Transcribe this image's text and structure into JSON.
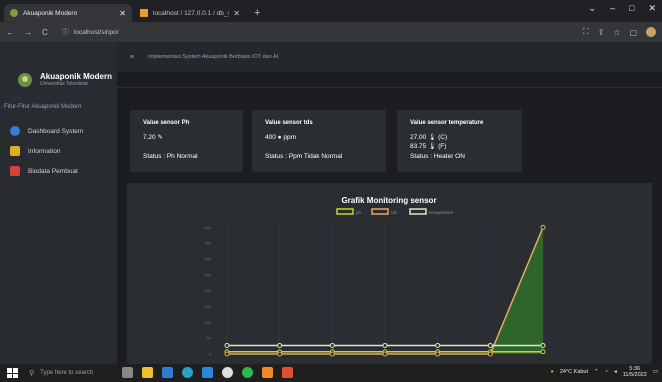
{
  "browser": {
    "tabs": [
      {
        "title": "Akuaponik Modern",
        "active": true
      },
      {
        "title": "localhost / 127.0.0.1 / db_siripo",
        "active": false
      }
    ],
    "new_tab": "+",
    "url": "localhost/siripo/",
    "controls": {
      "minimize": "–",
      "maximize": "□",
      "close": "✕"
    }
  },
  "sidebar": {
    "brand_name": "Akuaponik Modern",
    "brand_sub": "Universitas Teknokrat",
    "menu_header": "Fitur-Fitur Akuaponik Modern",
    "items": [
      {
        "label": "Dashboard System",
        "color": "#3b7bd9"
      },
      {
        "label": "Information",
        "color": "#e0b020"
      },
      {
        "label": "Biodata Pembuat",
        "color": "#d9403b"
      }
    ]
  },
  "topnav": {
    "title": "Implementasi System Akuaponik Berbasis IOT dan AI"
  },
  "cards": [
    {
      "title": "Value sensor Ph",
      "lines": [
        "7.20 ✎"
      ],
      "status": "Status : Ph Normal"
    },
    {
      "title": "Value sensor tds",
      "lines": [
        "400 ● ppm"
      ],
      "status": "Status : Ppm Tidak Normal"
    },
    {
      "title": "Value sensor temperature",
      "lines": [
        "27.00 🌡 (C)",
        "83.75 🌡 (F)"
      ],
      "status": "Status : Heater ON"
    }
  ],
  "chart_data": {
    "type": "line",
    "title": "Grafik Monitoring sensor",
    "series": [
      {
        "name": "ph",
        "color": "#c8d828",
        "values": [
          7,
          7,
          7,
          7,
          7,
          7,
          7
        ]
      },
      {
        "name": "tds",
        "color": "#e8a860",
        "values": [
          0,
          0,
          0,
          0,
          0,
          0,
          400
        ]
      },
      {
        "name": "temperature",
        "color": "#d8e8c8",
        "values": [
          27,
          27,
          27,
          27,
          27,
          27,
          27
        ]
      }
    ],
    "yticks": [
      0,
      50,
      100,
      150,
      200,
      250,
      300,
      350,
      400
    ],
    "ylim": [
      0,
      420
    ],
    "area_fill": "#2e6b2a"
  },
  "taskbar": {
    "search_placeholder": "Type here to search",
    "weather": "24°C Kabut",
    "time": "5:36",
    "date": "11/5/2022"
  }
}
